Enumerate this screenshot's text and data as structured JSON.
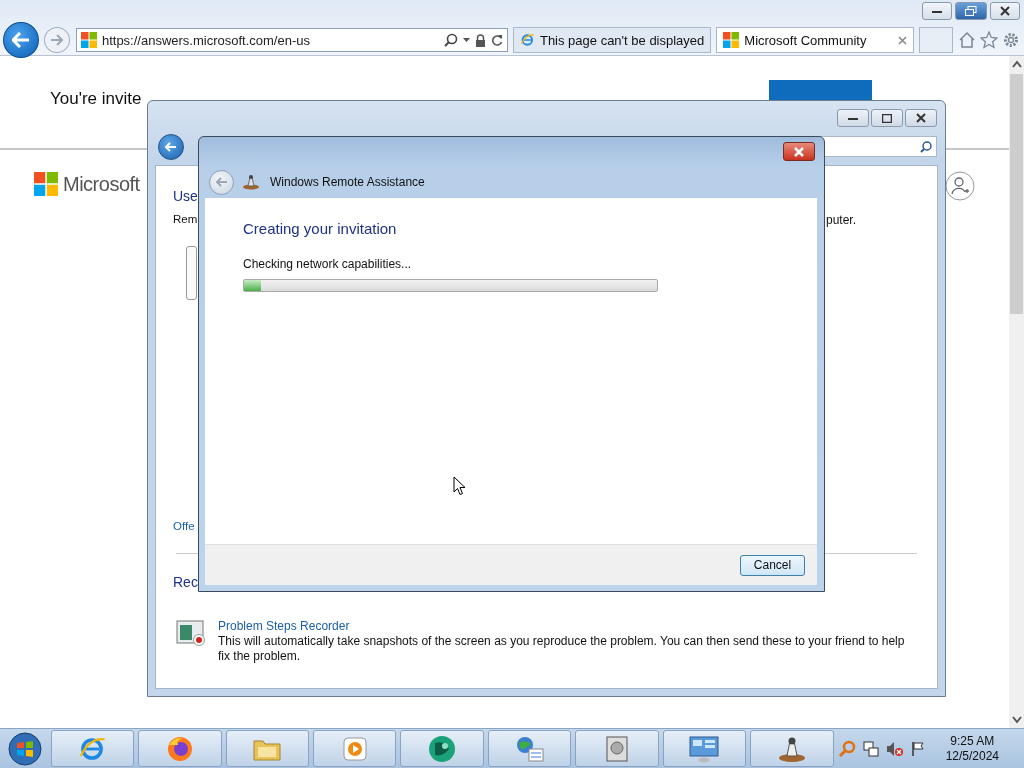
{
  "browser": {
    "address": "https://answers.microsoft.com/en-us",
    "tabs": [
      {
        "title": "This page can't be displayed",
        "kind": "error",
        "selected": false
      },
      {
        "title": "Microsoft Community",
        "kind": "site",
        "selected": true
      }
    ]
  },
  "page": {
    "heading": "You're invite",
    "logo_text": "Microsoft"
  },
  "back_window": {
    "heading": "Use",
    "line": "Rem",
    "line_end": "puter.",
    "link": "Offe",
    "section": "Rec",
    "tool": {
      "title": "Problem Steps Recorder",
      "description": "This will automatically take snapshots of the screen as you reproduce the problem. You can then send these to your friend to help fix the problem."
    }
  },
  "dialog": {
    "title": "Windows Remote Assistance",
    "heading": "Creating your invitation",
    "status": "Checking network capabilities...",
    "progress": {
      "level": 0.04
    },
    "buttons": [
      "Cancel"
    ]
  },
  "taskbar": {
    "apps": [
      {
        "kind": "ie"
      },
      {
        "kind": "firefox"
      },
      {
        "kind": "folder"
      },
      {
        "kind": "media"
      },
      {
        "kind": "green"
      },
      {
        "kind": "network"
      },
      {
        "kind": "disk"
      },
      {
        "kind": "panel"
      },
      {
        "kind": "assist"
      }
    ],
    "time": "9:25 AM",
    "date": "12/5/2024"
  }
}
